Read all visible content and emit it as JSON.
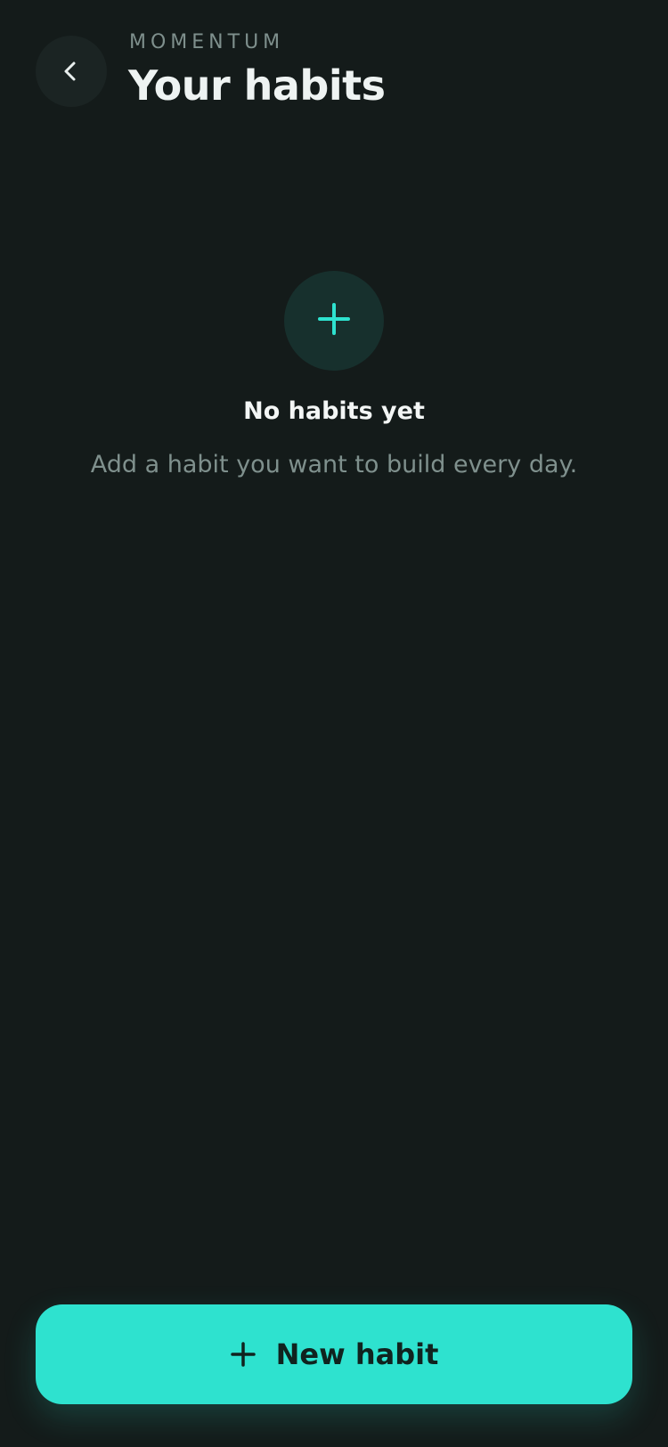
{
  "header": {
    "app_name": "MOMENTUM",
    "title": "Your habits"
  },
  "empty_state": {
    "icon": "plus-icon",
    "title": "No habits yet",
    "subtitle": "Add a habit you want to build every day."
  },
  "actions": {
    "back_icon": "chevron-left-icon",
    "new_habit_icon": "plus-icon",
    "new_habit_label": "New habit"
  },
  "colors": {
    "background": "#141b1a",
    "accent": "#2ee2cf",
    "title": "#eef3f2",
    "muted": "#7f908d"
  }
}
